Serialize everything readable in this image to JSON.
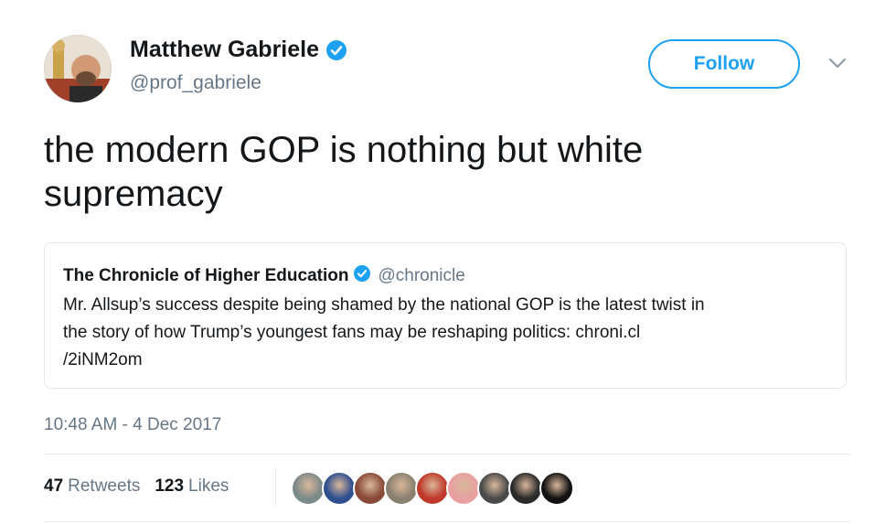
{
  "author": {
    "display_name": "Matthew Gabriele",
    "handle": "@prof_gabriele",
    "verified": true
  },
  "follow_button_label": "Follow",
  "tweet_text": "the modern GOP is nothing but white supremacy",
  "quoted_tweet": {
    "display_name": "The Chronicle of Higher Education",
    "handle": "@chronicle",
    "verified": true,
    "text_line1": "Mr. Allsup’s success despite being shamed by the national GOP is the latest twist in",
    "text_line2": "the story of how Trump’s youngest fans may be reshaping politics: chroni.cl",
    "text_line3": "/2iNM2om"
  },
  "timestamp": "10:48 AM - 4 Dec 2017",
  "stats": {
    "retweets_count": "47",
    "retweets_label": "Retweets",
    "likes_count": "123",
    "likes_label": "Likes"
  },
  "colors": {
    "accent": "#1da1f2",
    "secondary_text": "#657786",
    "border": "#e1e8ed"
  },
  "liker_avatars": [
    {
      "color": "#7d8a8a"
    },
    {
      "color": "#2f4f8f"
    },
    {
      "color": "#8a4a3a"
    },
    {
      "color": "#8a8070"
    },
    {
      "color": "#c0392b"
    },
    {
      "color": "#e8a0a0"
    },
    {
      "color": "#4a4a4a"
    },
    {
      "color": "#2a2a2a"
    },
    {
      "color": "#111111"
    }
  ]
}
